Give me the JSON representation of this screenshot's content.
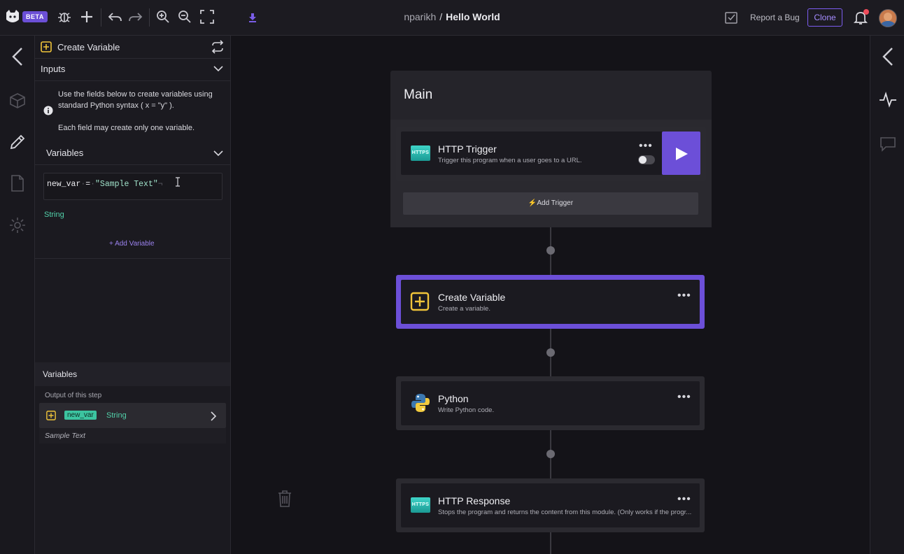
{
  "topbar": {
    "beta": "BETA",
    "user": "nparikh",
    "separator": "/",
    "project": "Hello World",
    "report_bug": "Report a Bug",
    "clone": "Clone"
  },
  "panel": {
    "title": "Create Variable",
    "inputs_label": "Inputs",
    "info_line1": "Use the fields below to create variables using",
    "info_line2": "standard Python syntax ( x = \"y\" ).",
    "info_line3": "Each field may create only one variable.",
    "variables_label": "Variables",
    "code_var": "new_var",
    "code_eq": "=",
    "code_value": "\"Sample Text\"",
    "type": "String",
    "add_variable": "+ Add Variable",
    "footer_title": "Variables",
    "output_label": "Output of this step",
    "output_var": "new_var",
    "output_type": "String",
    "output_sample": "Sample Text"
  },
  "canvas": {
    "group_title": "Main",
    "trigger": {
      "icon_text": "HTTPS",
      "title": "HTTP Trigger",
      "subtitle": "Trigger this program when a user goes to a URL.",
      "add_trigger": "Add Trigger"
    },
    "steps": [
      {
        "title": "Create Variable",
        "subtitle": "Create a variable."
      },
      {
        "title": "Python",
        "subtitle": "Write Python code."
      },
      {
        "title": "HTTP Response",
        "subtitle": "Stops the program and returns the content from this module. (Only works if the progr...",
        "icon_text": "HTTPS"
      }
    ]
  },
  "colors": {
    "accent": "#6c4fd8",
    "teal": "#3cc4a0",
    "yellow": "#f0c43a"
  }
}
